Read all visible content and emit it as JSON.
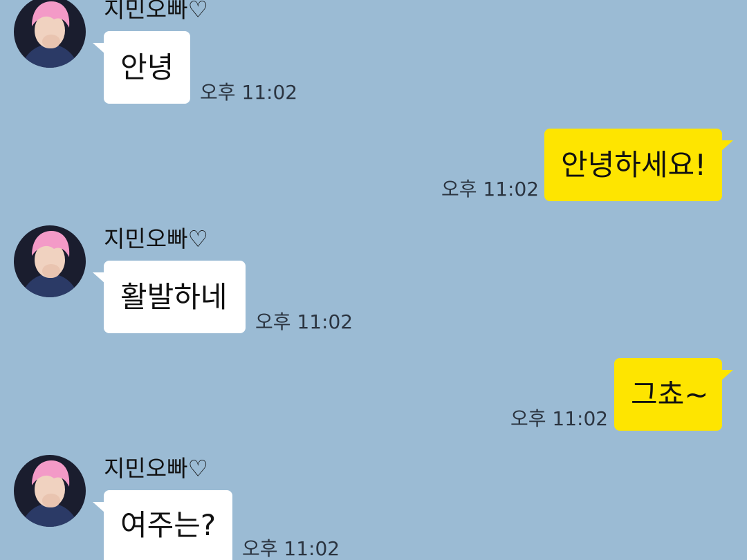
{
  "colors": {
    "background": "#9bbbd4",
    "incoming_bubble": "#ffffff",
    "outgoing_bubble": "#fee500",
    "avatar_hair": "#f39ac7"
  },
  "messages": [
    {
      "direction": "incoming",
      "sender": "지민오빠♡",
      "avatar": "profile-photo",
      "text": "안녕",
      "time": "오후 11:02"
    },
    {
      "direction": "outgoing",
      "text": "안녕하세요!",
      "time": "오후 11:02"
    },
    {
      "direction": "incoming",
      "sender": "지민오빠♡",
      "avatar": "profile-photo",
      "text": "활발하네",
      "time": "오후 11:02"
    },
    {
      "direction": "outgoing",
      "text": "그쵸~",
      "time": "오후 11:02"
    },
    {
      "direction": "incoming",
      "sender": "지민오빠♡",
      "avatar": "profile-photo",
      "text": "여주는?",
      "time": "오후 11:02"
    }
  ]
}
